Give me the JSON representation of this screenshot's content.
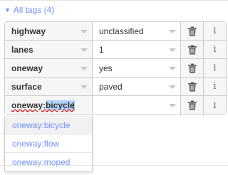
{
  "section": {
    "title": "All tags (4)",
    "toggle_icon": "triangle-down"
  },
  "tags": [
    {
      "key": "highway",
      "value": "unclassified"
    },
    {
      "key": "lanes",
      "value": "1"
    },
    {
      "key": "oneway",
      "value": "yes"
    },
    {
      "key": "surface",
      "value": "paved"
    }
  ],
  "editing_row": {
    "key_prefix": "oneway:",
    "key_highlighted": "bicycle",
    "value": ""
  },
  "suggestions": [
    {
      "label": "oneway:bicycle"
    },
    {
      "label": "oneway:flow"
    },
    {
      "label": "oneway:moped"
    }
  ],
  "icons": {
    "delete": "trash-icon",
    "info": "info-icon",
    "dropdown": "caret-down-icon"
  },
  "info_glyph": "i",
  "colors": {
    "link": "#7092ff",
    "highlight": "#b3d4ff",
    "key_bg": "#f6f6f6",
    "border": "#cccccc"
  }
}
